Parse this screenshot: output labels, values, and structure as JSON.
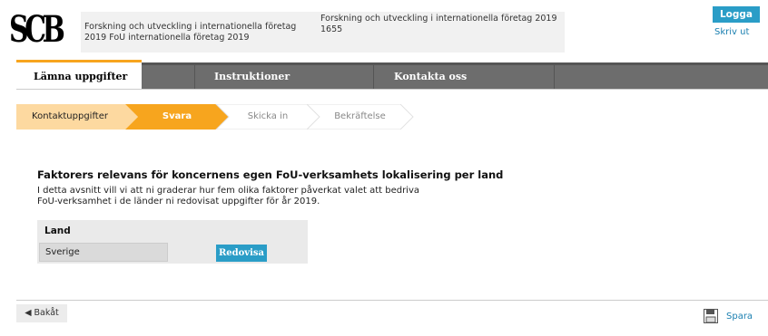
{
  "logo": {
    "text": "SCB"
  },
  "header": {
    "info_left_line1": "Forskning och utveckling i internationella företag",
    "info_left_line2": "2019 FoU internationella företag 2019",
    "info_right_line1": "Forskning och utveckling i internationella företag 2019",
    "info_right_line2": "1655",
    "logout_label": "Logga ut",
    "print_label": "Skriv ut"
  },
  "nav": {
    "tabs": [
      {
        "label": "Lämna uppgifter",
        "active": true
      },
      {
        "label": "Instruktioner",
        "active": false
      },
      {
        "label": "Kontakta oss",
        "active": false
      }
    ]
  },
  "steps": [
    {
      "label": "Kontaktuppgifter",
      "state": "done"
    },
    {
      "label": "Svara",
      "state": "current"
    },
    {
      "label": "Skicka in",
      "state": "todo"
    },
    {
      "label": "Bekräftelse",
      "state": "todo"
    }
  ],
  "content": {
    "title": "Faktorers relevans för koncernens egen FoU-verksamhets lokalisering per land",
    "paragraph_line1": "I detta avsnitt vill vi att ni graderar hur fem olika faktorer påverkat valet att bedriva",
    "paragraph_line2": "FoU-verksamhet i de länder ni redovisat uppgifter för år 2019.",
    "table": {
      "header": "Land",
      "rows": [
        {
          "country": "Sverige",
          "action_label": "Redovisa"
        }
      ]
    }
  },
  "footer": {
    "back_label": "◀ Bakåt",
    "save_label": "Spara"
  },
  "colors": {
    "accent_blue": "#2a9dc7",
    "accent_orange": "#f7a51e",
    "step_done": "#fdd9a0",
    "nav_gray": "#6d6d6d"
  }
}
